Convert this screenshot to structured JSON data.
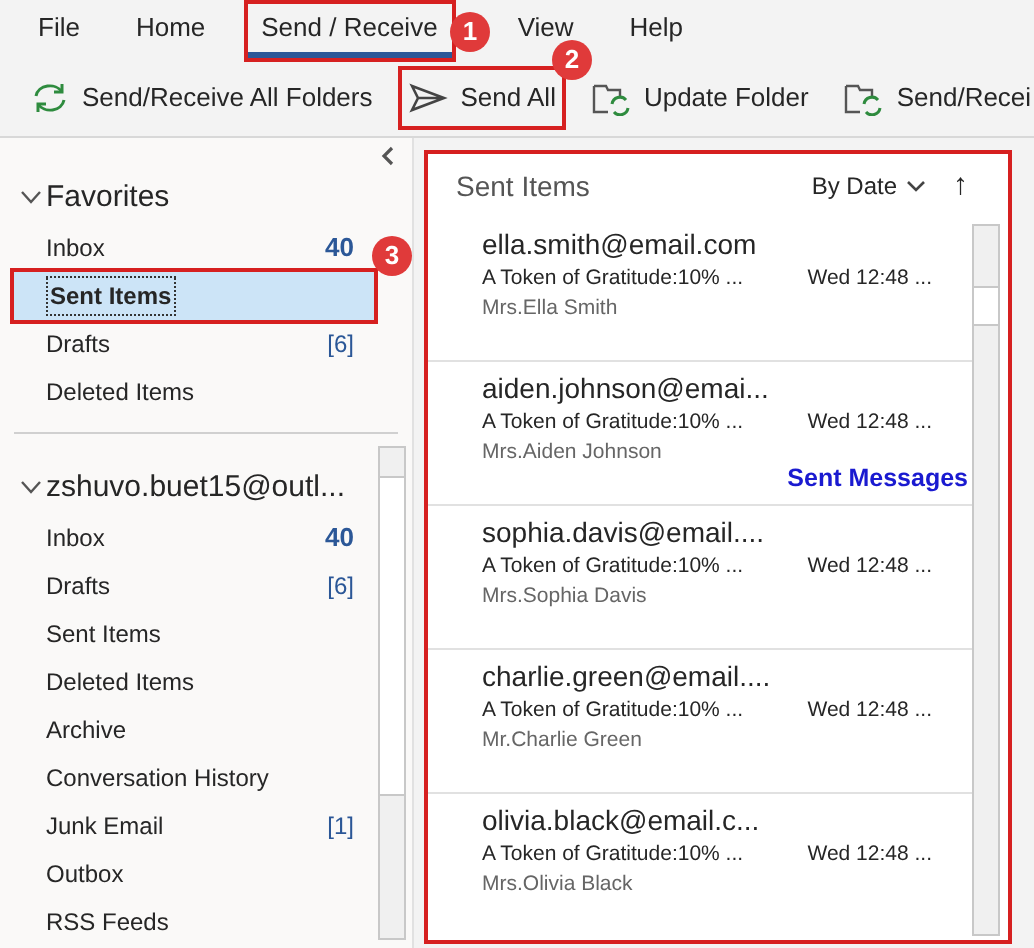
{
  "menu_tabs": [
    {
      "label": "File",
      "selected": false
    },
    {
      "label": "Home",
      "selected": false
    },
    {
      "label": "Send / Receive",
      "selected": true
    },
    {
      "label": "View",
      "selected": false
    },
    {
      "label": "Help",
      "selected": false
    }
  ],
  "ribbon": [
    {
      "label": "Send/Receive All Folders",
      "kind": "sync"
    },
    {
      "label": "Send All",
      "kind": "send"
    },
    {
      "label": "Update Folder",
      "kind": "folder"
    },
    {
      "label": "Send/Recei",
      "kind": "folder"
    }
  ],
  "folder_pane": {
    "favorites": {
      "title": "Favorites",
      "expanded": true,
      "items": [
        {
          "label": "Inbox",
          "count": "40",
          "unread": true,
          "selected": false
        },
        {
          "label": "Sent Items",
          "unread": false,
          "selected": true
        },
        {
          "label": "Drafts",
          "count": "[6]",
          "unread": false,
          "selected": false
        },
        {
          "label": "Deleted Items",
          "unread": false,
          "selected": false
        }
      ]
    },
    "account": {
      "title": "zshuvo.buet15@outl...",
      "expanded": true,
      "items": [
        {
          "label": "Inbox",
          "count": "40",
          "unread": true,
          "selected": false
        },
        {
          "label": "Drafts",
          "count": "[6]",
          "unread": false,
          "selected": false
        },
        {
          "label": "Sent Items",
          "unread": false,
          "selected": false
        },
        {
          "label": "Deleted Items",
          "unread": false,
          "selected": false
        },
        {
          "label": "Archive",
          "unread": false,
          "selected": false
        },
        {
          "label": "Conversation History",
          "unread": false,
          "selected": false
        },
        {
          "label": "Junk Email",
          "count": "[1]",
          "unread": false,
          "selected": false
        },
        {
          "label": "Outbox",
          "unread": false,
          "selected": false
        },
        {
          "label": "RSS Feeds",
          "unread": false,
          "selected": false
        }
      ]
    }
  },
  "message_list": {
    "title": "Sent Items",
    "sort": "By Date",
    "sort_direction": "↑",
    "messages": [
      {
        "to": "ella.smith@email.com",
        "subject": "A Token of Gratitude:10% ...",
        "date": "Wed 12:48 ...",
        "name": "Mrs.Ella Smith"
      },
      {
        "to": "aiden.johnson@emai...",
        "subject": "A Token of Gratitude:10% ...",
        "date": "Wed 12:48 ...",
        "name": "Mrs.Aiden Johnson",
        "annotation": "Sent Messages"
      },
      {
        "to": "sophia.davis@email....",
        "subject": "A Token of Gratitude:10% ...",
        "date": "Wed 12:48 ...",
        "name": "Mrs.Sophia Davis"
      },
      {
        "to": "charlie.green@email....",
        "subject": "A Token of Gratitude:10% ...",
        "date": "Wed 12:48 ...",
        "name": "Mr.Charlie Green"
      },
      {
        "to": "olivia.black@email.c...",
        "subject": "A Token of Gratitude:10% ...",
        "date": "Wed 12:48 ...",
        "name": "Mrs.Olivia Black"
      }
    ]
  },
  "annotations": {
    "steps": [
      "1",
      "2",
      "3"
    ]
  }
}
